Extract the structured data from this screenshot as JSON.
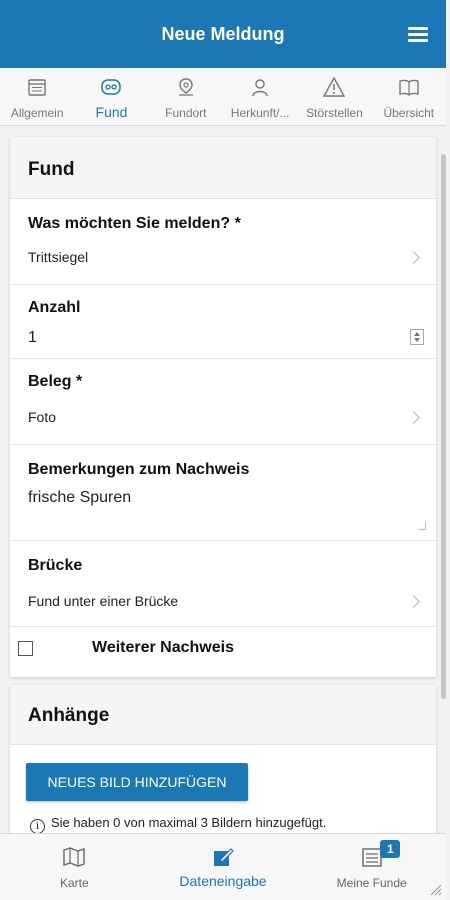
{
  "header": {
    "title": "Neue Meldung",
    "menu_icon": "hamburger-menu-icon",
    "background": "#1b78b4"
  },
  "tabs": [
    {
      "label": "Allgemein",
      "icon": "calendar-icon",
      "active": false
    },
    {
      "label": "Fund",
      "icon": "paw-icon",
      "active": true
    },
    {
      "label": "Fundort",
      "icon": "location-pin-icon",
      "active": false
    },
    {
      "label": "Herkunft/...",
      "icon": "person-icon",
      "active": false
    },
    {
      "label": "Störstellen",
      "icon": "warning-icon",
      "active": false
    },
    {
      "label": "Übersicht",
      "icon": "book-icon",
      "active": false
    }
  ],
  "fund": {
    "heading": "Fund",
    "fields": {
      "was": {
        "label": "Was möchten Sie melden? *",
        "value": "Trittsiegel"
      },
      "anzahl": {
        "label": "Anzahl",
        "value": "1"
      },
      "beleg": {
        "label": "Beleg *",
        "value": "Foto"
      },
      "bemerkungen": {
        "label": "Bemerkungen zum Nachweis",
        "value": "frische Spuren"
      },
      "bruecke": {
        "label": "Brücke",
        "value": "Fund unter einer Brücke"
      }
    },
    "weiterer_nachweis": {
      "label": "Weiterer Nachweis",
      "checked": false
    }
  },
  "anhaenge": {
    "heading": "Anhänge",
    "button_label": "NEUES BILD HINZUFÜGEN",
    "info_text": "Sie haben 0 von maximal 3 Bildern hinzugefügt."
  },
  "bottom_nav": [
    {
      "label": "Karte",
      "icon": "map-icon",
      "active": false
    },
    {
      "label": "Dateneingabe",
      "icon": "edit-icon",
      "active": true
    },
    {
      "label": "Meine Funde",
      "icon": "list-icon",
      "active": false,
      "badge": "1"
    }
  ]
}
